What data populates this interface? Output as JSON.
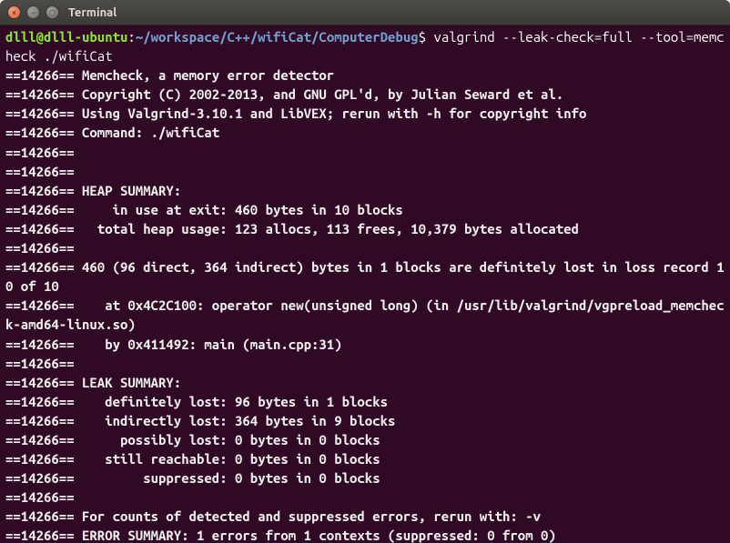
{
  "window": {
    "title": "Terminal"
  },
  "prompt": {
    "user_host": "dlll@dlll-ubuntu",
    "separator": ":",
    "path": "~/workspace/C++/wifiCat/ComputerDebug",
    "dollar": "$",
    "command": "valgrind --leak-check=full --tool=memcheck ./wifiCat"
  },
  "pid_prefix": "==14266==",
  "lines": {
    "l0": "==14266== Memcheck, a memory error detector",
    "l1": "==14266== Copyright (C) 2002-2013, and GNU GPL'd, by Julian Seward et al.",
    "l2": "==14266== Using Valgrind-3.10.1 and LibVEX; rerun with -h for copyright info",
    "l3": "==14266== Command: ./wifiCat",
    "l4": "==14266== ",
    "l5": "==14266== ",
    "l6": "==14266== HEAP SUMMARY:",
    "l7": "==14266==     in use at exit: 460 bytes in 10 blocks",
    "l8": "==14266==   total heap usage: 123 allocs, 113 frees, 10,379 bytes allocated",
    "l9": "==14266== ",
    "l10": "==14266== 460 (96 direct, 364 indirect) bytes in 1 blocks are definitely lost in loss record 10 of 10",
    "l11": "==14266==    at 0x4C2C100: operator new(unsigned long) (in /usr/lib/valgrind/vgpreload_memcheck-amd64-linux.so)",
    "l12": "==14266==    by 0x411492: main (main.cpp:31)",
    "l13": "==14266== ",
    "l14": "==14266== LEAK SUMMARY:",
    "l15": "==14266==    definitely lost: 96 bytes in 1 blocks",
    "l16": "==14266==    indirectly lost: 364 bytes in 9 blocks",
    "l17": "==14266==      possibly lost: 0 bytes in 0 blocks",
    "l18": "==14266==    still reachable: 0 bytes in 0 blocks",
    "l19": "==14266==         suppressed: 0 bytes in 0 blocks",
    "l20": "==14266== ",
    "l21": "==14266== For counts of detected and suppressed errors, rerun with: -v",
    "l22": "==14266== ERROR SUMMARY: 1 errors from 1 contexts (suppressed: 0 from 0)"
  }
}
